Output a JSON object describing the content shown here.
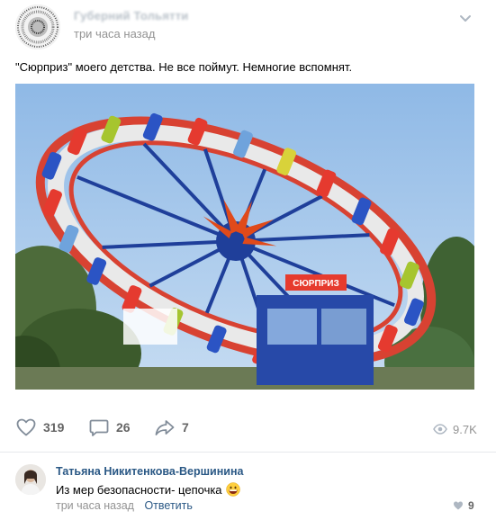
{
  "post": {
    "author": "Губерний Тольятти",
    "time": "три часа назад",
    "text": "\"Сюрприз\" моего детства. Не все поймут. Немногие вспомнят.",
    "image_sign": "СЮРПРИЗ"
  },
  "actions": {
    "likes": "319",
    "comments": "26",
    "shares": "7",
    "views": "9.7K"
  },
  "comment": {
    "author": "Татьяна Никитенкова-Вершинина",
    "text": "Из мер безопасности- цепочка",
    "time": "три часа назад",
    "reply_label": "Ответить",
    "likes": "9"
  },
  "icons": {
    "menu": "chevron-down-icon",
    "like": "heart-icon",
    "comment": "speech-bubble-icon",
    "share": "share-arrow-icon",
    "views": "eye-icon",
    "emoji": "grinning-face-icon"
  },
  "colors": {
    "link": "#2a5885",
    "muted": "#939393",
    "icon": "#818c99",
    "sky": "#9ec3ea"
  }
}
